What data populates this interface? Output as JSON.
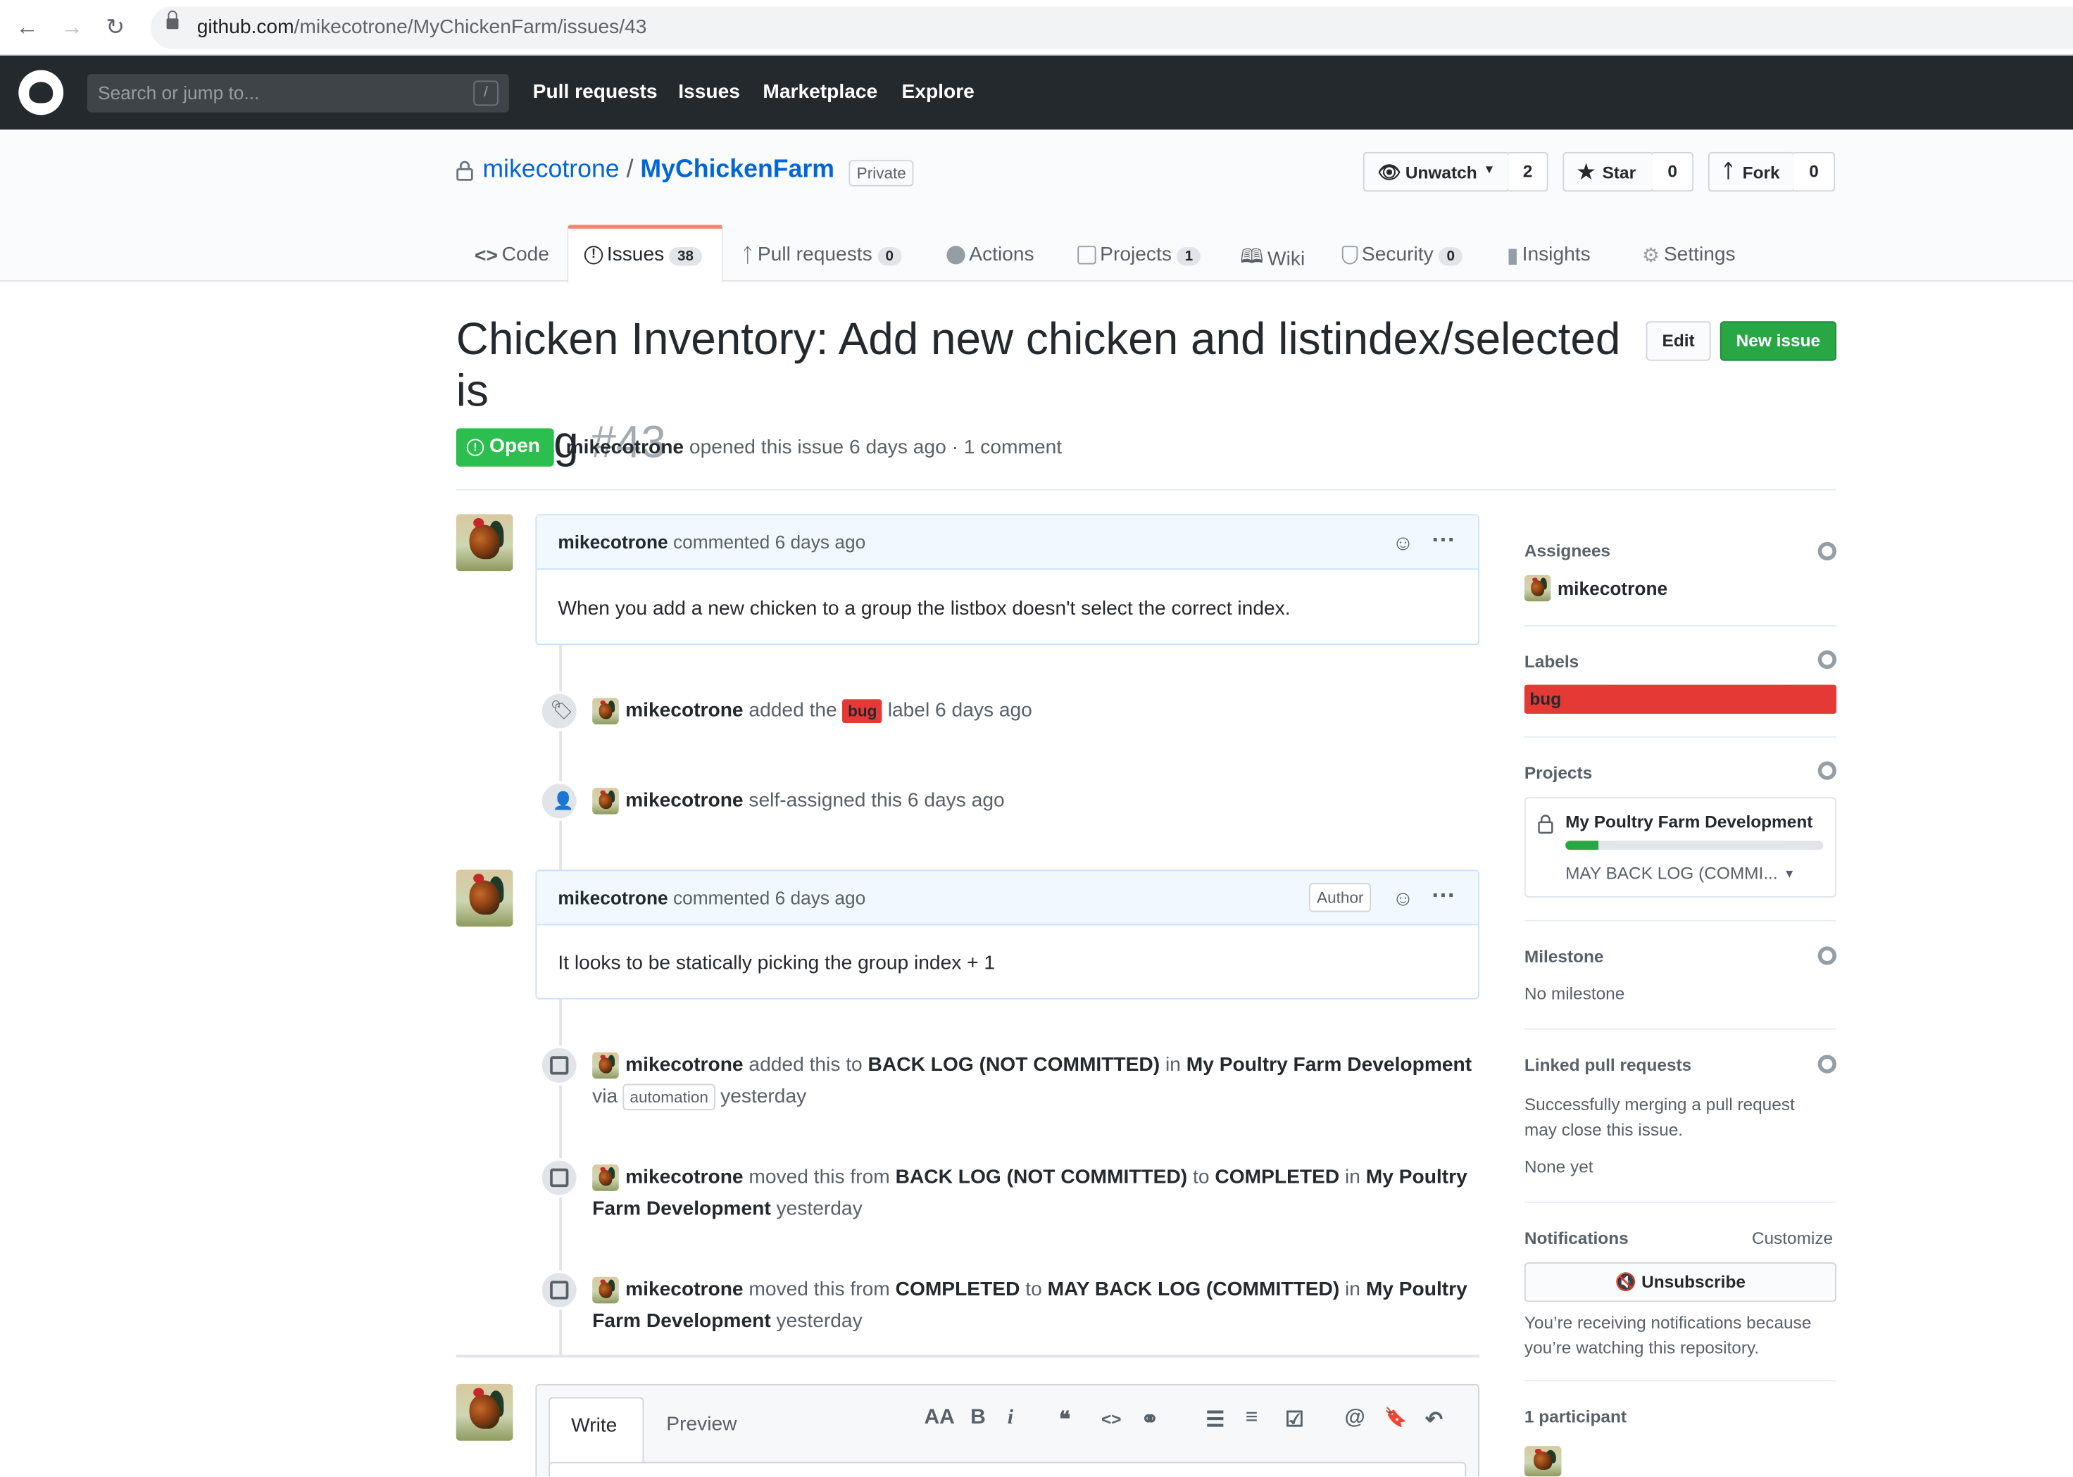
{
  "browser": {
    "url_host": "github.com",
    "url_path": "/mikecotrone/MyChickenFarm/issues/43"
  },
  "header": {
    "search_placeholder": "Search or jump to...",
    "slash_key": "/",
    "nav": [
      "Pull requests",
      "Issues",
      "Marketplace",
      "Explore"
    ]
  },
  "repo": {
    "owner": "mikecotrone",
    "separator": "/",
    "name": "MyChickenFarm",
    "visibility": "Private",
    "unwatch_label": "Unwatch",
    "watch_count": "2",
    "star_label": "Star",
    "star_count": "0",
    "fork_label": "Fork",
    "fork_count": "0"
  },
  "tabs": [
    {
      "label": "Code"
    },
    {
      "label": "Issues",
      "count": "38"
    },
    {
      "label": "Pull requests",
      "count": "0"
    },
    {
      "label": "Actions"
    },
    {
      "label": "Projects",
      "count": "1"
    },
    {
      "label": "Wiki"
    },
    {
      "label": "Security",
      "count": "0"
    },
    {
      "label": "Insights"
    },
    {
      "label": "Settings"
    }
  ],
  "issue": {
    "title_line1": "Chicken Inventory: Add new chicken and listindex/selected is",
    "title_line2": "wrong",
    "number": "#43",
    "state": "Open",
    "author": "mikecotrone",
    "meta": "opened this issue 6 days ago · 1 comment",
    "edit_label": "Edit",
    "new_issue_label": "New issue"
  },
  "comments": [
    {
      "author": "mikecotrone",
      "meta": "commented 6 days ago",
      "body": "When you add a new chicken to a group the listbox doesn't select the correct index."
    },
    {
      "author": "mikecotrone",
      "meta": "commented 6 days ago",
      "badge": "Author",
      "body": "It looks to be statically picking the group index + 1"
    }
  ],
  "events": {
    "label": {
      "user": "mikecotrone",
      "pre": "added the",
      "label": "bug",
      "post": "label 6 days ago"
    },
    "assign": {
      "user": "mikecotrone",
      "text": "self-assigned this 6 days ago"
    },
    "proj1": {
      "user": "mikecotrone",
      "t1": "added this to",
      "col": "BACK LOG (NOT COMMITTED)",
      "t2": "in",
      "project": "My Poultry Farm Development",
      "via": "via",
      "tag": "automation",
      "when": "yesterday"
    },
    "proj2": {
      "user": "mikecotrone",
      "t1": "moved this from",
      "from": "BACK LOG (NOT COMMITTED)",
      "t2": "to",
      "to": "COMPLETED",
      "t3": "in",
      "project1": "My Poultry",
      "project2": "Farm Development",
      "when": "yesterday"
    },
    "proj3": {
      "user": "mikecotrone",
      "t1": "moved this from",
      "from": "COMPLETED",
      "t2": "to",
      "to": "MAY BACK LOG (COMMITTED)",
      "t3": "in",
      "project1": "My Poultry",
      "project2": "Farm Development",
      "when": "yesterday"
    }
  },
  "editor": {
    "write_tab": "Write",
    "preview_tab": "Preview",
    "tools": [
      "AA",
      "B",
      "i",
      "❝",
      "<>",
      "⚭",
      "☰",
      "≡",
      "☑",
      "@",
      "🔖",
      "↶"
    ]
  },
  "sidebar": {
    "assignees_h": "Assignees",
    "assignee": "mikecotrone",
    "labels_h": "Labels",
    "label": "bug",
    "label_color": "#e53935",
    "projects_h": "Projects",
    "project_name": "My Poultry Farm Development",
    "project_progress": 0.13,
    "project_column": "MAY BACK LOG (COMMI...",
    "milestone_h": "Milestone",
    "milestone": "No milestone",
    "linked_h": "Linked pull requests",
    "linked_text1": "Successfully merging a pull request",
    "linked_text2": "may close this issue.",
    "linked_none": "None yet",
    "notif_h": "Notifications",
    "customize": "Customize",
    "unsubscribe": "Unsubscribe",
    "notif_text1": "You’re receiving notifications because",
    "notif_text2": "you’re watching this repository.",
    "participants": "1 participant"
  },
  "colors": {
    "accent": "#0366d6",
    "open_green": "#2cbe4e",
    "new_issue_green": "#28a745",
    "header_dark": "#24292e",
    "tab_active": "#f9826c"
  }
}
